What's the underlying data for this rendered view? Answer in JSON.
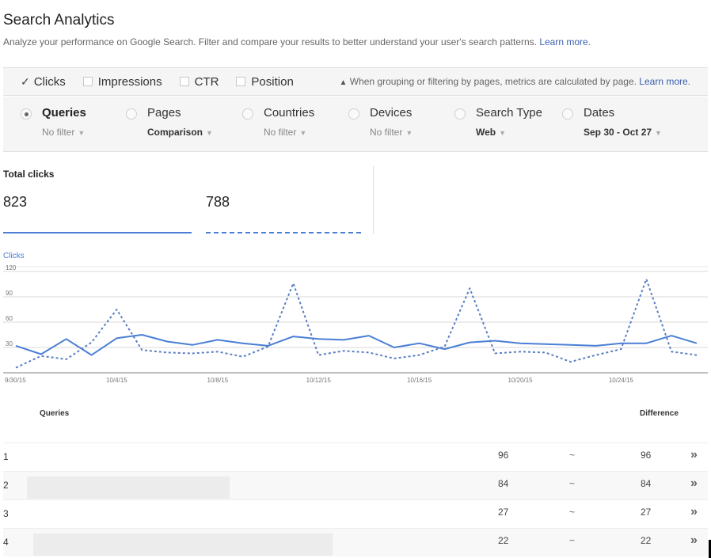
{
  "header": {
    "title": "Search Analytics",
    "subtitle": "Analyze your performance on Google Search. Filter and compare your results to better understand your user's search patterns.",
    "learn_more": "Learn more."
  },
  "metrics": {
    "items": [
      {
        "label": "Clicks",
        "checked": true
      },
      {
        "label": "Impressions",
        "checked": false
      },
      {
        "label": "CTR",
        "checked": false
      },
      {
        "label": "Position",
        "checked": false
      }
    ],
    "warning_icon": "warning-triangle-icon",
    "warning": "When grouping or filtering by pages, metrics are calculated by page.",
    "warning_link": "Learn more."
  },
  "filters": [
    {
      "label": "Queries",
      "value": "No filter",
      "selected": true
    },
    {
      "label": "Pages",
      "value": "Comparison",
      "selected": false
    },
    {
      "label": "Countries",
      "value": "No filter",
      "selected": false
    },
    {
      "label": "Devices",
      "value": "No filter",
      "selected": false
    },
    {
      "label": "Search Type",
      "value": "Web",
      "selected": false
    },
    {
      "label": "Dates",
      "value": "Sep 30 - Oct 27",
      "selected": false
    }
  ],
  "summary": {
    "label": "Total clicks",
    "value_a": "823",
    "value_b": "788"
  },
  "chart_data": {
    "type": "line",
    "title": "Clicks",
    "xlabel": "",
    "ylabel": "",
    "ylim": [
      0,
      120
    ],
    "yticks": [
      30,
      60,
      90,
      120
    ],
    "xtick_labels": [
      "9/30/15",
      "10/4/15",
      "10/8/15",
      "10/12/15",
      "10/16/15",
      "10/20/15",
      "10/24/15"
    ],
    "x": [
      "9/30",
      "10/1",
      "10/2",
      "10/3",
      "10/4",
      "10/5",
      "10/6",
      "10/7",
      "10/8",
      "10/9",
      "10/10",
      "10/11",
      "10/12",
      "10/13",
      "10/14",
      "10/15",
      "10/16",
      "10/17",
      "10/18",
      "10/19",
      "10/20",
      "10/21",
      "10/22",
      "10/23",
      "10/24",
      "10/25",
      "10/26",
      "10/27"
    ],
    "grid": true,
    "series": [
      {
        "name": "Clicks (A)",
        "style": "solid",
        "values": [
          32,
          22,
          40,
          21,
          41,
          45,
          37,
          33,
          39,
          35,
          32,
          43,
          40,
          39,
          44,
          30,
          35,
          28,
          36,
          38,
          35,
          34,
          33,
          32,
          35,
          35,
          44,
          35
        ]
      },
      {
        "name": "Clicks (B)",
        "style": "dashed",
        "values": [
          6,
          20,
          16,
          36,
          75,
          27,
          24,
          23,
          25,
          19,
          31,
          106,
          21,
          26,
          24,
          17,
          21,
          31,
          100,
          23,
          25,
          24,
          13,
          21,
          28,
          111,
          25,
          21
        ]
      }
    ]
  },
  "table": {
    "columns": [
      "Queries",
      "Difference"
    ],
    "rows": [
      {
        "rank": "1",
        "query": "",
        "value_a": "96",
        "value_b": "~",
        "difference": "96"
      },
      {
        "rank": "2",
        "query": "",
        "value_a": "84",
        "value_b": "~",
        "difference": "84"
      },
      {
        "rank": "3",
        "query": "",
        "value_a": "27",
        "value_b": "~",
        "difference": "27"
      },
      {
        "rank": "4",
        "query": "",
        "value_a": "22",
        "value_b": "~",
        "difference": "22"
      }
    ],
    "row_action_icon": "double-chevron-right-icon"
  }
}
